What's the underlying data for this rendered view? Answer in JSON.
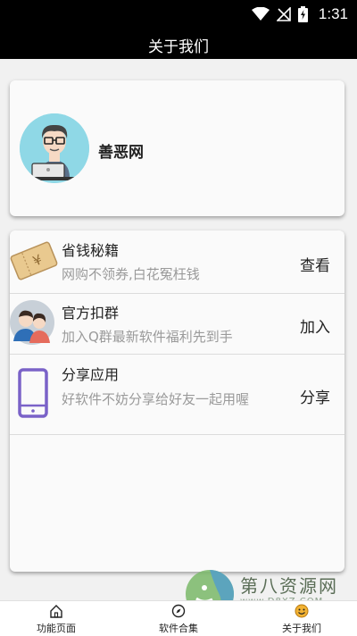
{
  "status_bar": {
    "time": "1:31"
  },
  "header": {
    "title": "关于我们"
  },
  "profile": {
    "name": "善恶网"
  },
  "list": [
    {
      "title": "省钱秘籍",
      "desc": "网购不领券,白花冤枉钱",
      "action": "查看",
      "icon": "coupon-icon"
    },
    {
      "title": "官方扣群",
      "desc": "加入Q群最新软件福利先到手",
      "action": "加入",
      "icon": "group-avatar-icon"
    },
    {
      "title": "分享应用",
      "desc": "好软件不妨分享给好友一起用喔",
      "action": "分享",
      "icon": "phone-icon"
    }
  ],
  "nav": [
    {
      "label": "功能页面",
      "icon": "home-icon"
    },
    {
      "label": "软件合集",
      "icon": "compass-icon"
    },
    {
      "label": "关于我们",
      "icon": "smiley-icon"
    }
  ],
  "watermark": {
    "title": "第八资源网",
    "url": "www.D8XZ.COM"
  }
}
